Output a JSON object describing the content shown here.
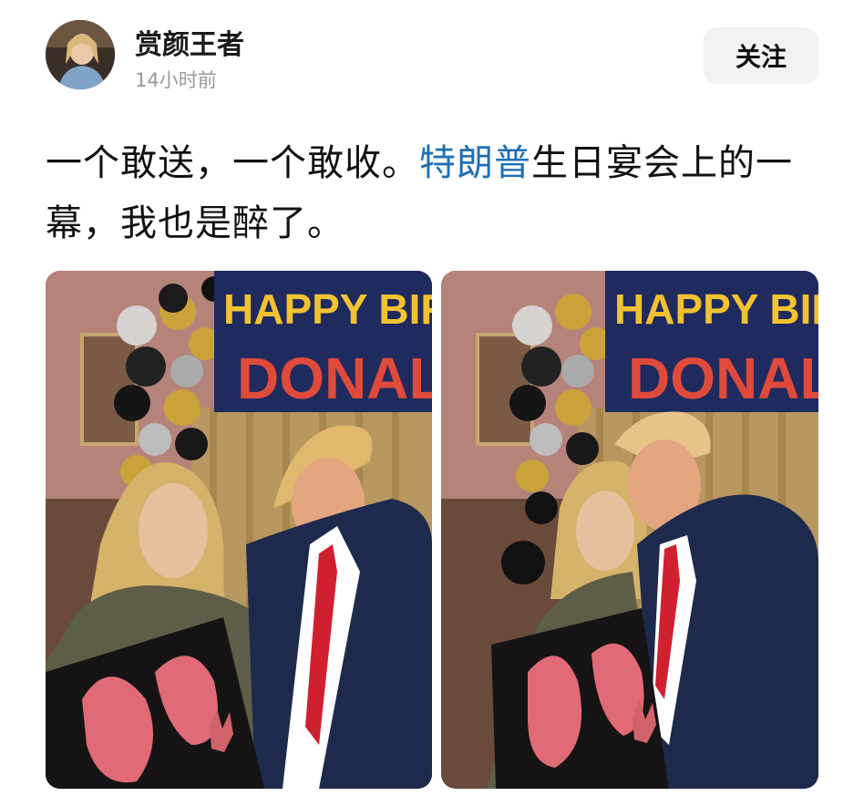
{
  "post": {
    "author": "赏颜王者",
    "time": "14小时前",
    "follow_label": "关注",
    "text_part1": "一个敢送，一个敢收。",
    "text_link": "特朗普",
    "text_part2": "生日宴会上的一幕，我也是醉了。"
  },
  "photos": [
    {
      "banner_line1": "HAPPY BIRT",
      "banner_line2": "DONALD"
    },
    {
      "banner_line1": "HAPPY BIRT",
      "banner_line2": "DONALD"
    }
  ],
  "colors": {
    "link": "#1f6fb5",
    "banner_bg": "#1f2a5e",
    "banner_text_yellow": "#f2c230",
    "banner_text_red": "#e04a3a"
  }
}
